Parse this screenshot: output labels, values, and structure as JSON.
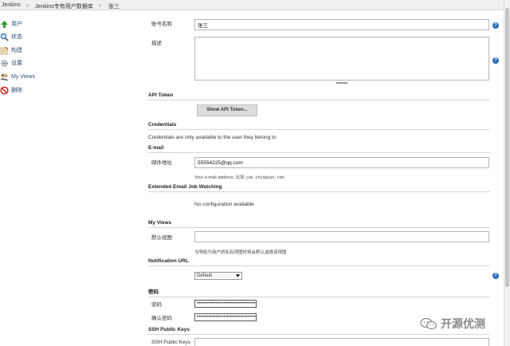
{
  "breadcrumb": [
    "Jenkins",
    "Jenkins专有用户数据库",
    "张三"
  ],
  "breadcrumb_separator": "›",
  "sidebar": {
    "items": [
      {
        "label": "用户",
        "icon": "up-arrow-icon",
        "color": "#3a9a2a"
      },
      {
        "label": "状态",
        "icon": "magnifier-icon",
        "color": "#2a6cb8"
      },
      {
        "label": "构建",
        "icon": "notepad-icon",
        "color": "#c49a3a"
      },
      {
        "label": "设置",
        "icon": "gear-icon",
        "color": "#6a7a8a"
      },
      {
        "label": "My Views",
        "icon": "users-icon",
        "color": "#7a5a3a"
      },
      {
        "label": "删除",
        "icon": "no-entry-icon",
        "color": "#d02020"
      }
    ]
  },
  "account": {
    "name_label": "账号名称",
    "name_value": "张三",
    "description_label": "描述",
    "description_value": ""
  },
  "api_token": {
    "header": "API Token",
    "button_label": "Show API Token..."
  },
  "credentials": {
    "header": "Credentials",
    "text": "Credentials are only available to the user they belong to"
  },
  "email": {
    "header": "E-mail",
    "label": "邮件地址",
    "value": "55554225@qq.com",
    "hint_prefix": "Your e-mail address, 比如",
    "hint_example": "joe.chin@sun.com"
  },
  "extended_email": {
    "header": "Extended Email Job Watching",
    "text": "No configuration available"
  },
  "my_views": {
    "header": "My Views",
    "label": "默认视图",
    "value": "",
    "hint": "当导航为用户的私有视图时将会默认选择该视图"
  },
  "notification": {
    "header": "Notification URL",
    "select_value": "Default"
  },
  "password": {
    "header": "密码",
    "password_label": "密码",
    "confirm_label": "确认密码",
    "masked": "••••••••••••••••••••••••••••••••••••••"
  },
  "ssh": {
    "header": "SSH Public Keys",
    "label": "SSH Public Keys"
  },
  "help_glyph": "?",
  "watermark": "开源优测",
  "colors": {
    "help": "#2a6cb8",
    "link": "#2c4f7a"
  }
}
